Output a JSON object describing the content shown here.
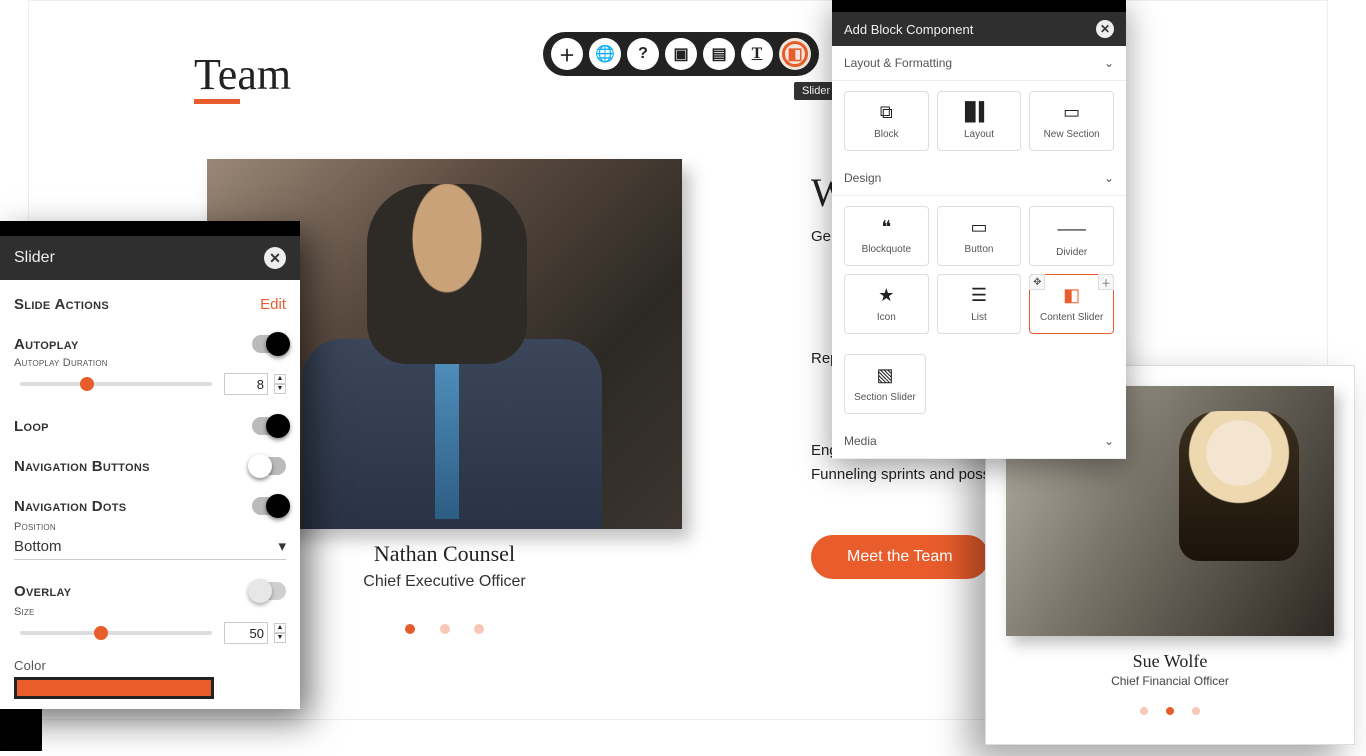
{
  "page": {
    "title": "Team",
    "team_member_name": "Nathan Counsel",
    "team_member_role": "Chief Executive Officer",
    "who_title": "Who",
    "para1": "Generat increase increase turn inn",
    "para2": "Repurpo up with a benchma",
    "para3": "Engage benchmarking to, conseq offline. Execute user experience Funneling sprints and possibly i outcomes.",
    "meet_button": "Meet the Team"
  },
  "toolbar": {
    "tooltip": "Slider"
  },
  "slider_panel": {
    "title": "Slider",
    "slide_actions_label": "Slide Actions",
    "edit_label": "Edit",
    "autoplay_label": "Autoplay",
    "autoplay_duration_label": "Autoplay Duration",
    "autoplay_duration_value": "8",
    "loop_label": "Loop",
    "nav_buttons_label": "Navigation Buttons",
    "nav_dots_label": "Navigation Dots",
    "position_label": "Position",
    "position_value": "Bottom",
    "overlay_label": "Overlay",
    "size_label": "Size",
    "size_value": "50",
    "color_label": "Color"
  },
  "abc": {
    "title": "Add Block Component",
    "cat_layout": "Layout & Formatting",
    "cat_design": "Design",
    "cat_media": "Media",
    "items_layout": {
      "block": "Block",
      "layout": "Layout",
      "new_section": "New Section"
    },
    "items_design": {
      "blockquote": "Blockquote",
      "button": "Button",
      "divider": "Divider",
      "icon": "Icon",
      "list": "List",
      "content_slider": "Content Slider",
      "section_slider": "Section Slider"
    }
  },
  "card2": {
    "name": "Sue Wolfe",
    "role": "Chief Financial Officer"
  }
}
